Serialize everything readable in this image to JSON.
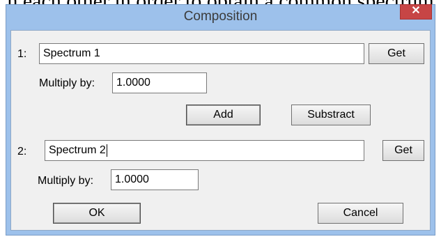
{
  "background_text": "h each other in order to obtain a common spectrum",
  "window": {
    "title": "Composition",
    "close_glyph": "✕"
  },
  "row1": {
    "index_label": "1:",
    "spectrum_value": "Spectrum 1",
    "get_label": "Get",
    "multiply_label": "Multiply by:",
    "multiply_value": "1.0000"
  },
  "ops": {
    "add_label": "Add",
    "substract_label": "Substract"
  },
  "row2": {
    "index_label": "2:",
    "spectrum_value": "Spectrum 2",
    "get_label": "Get",
    "multiply_label": "Multiply by:",
    "multiply_value": "1.0000"
  },
  "actions": {
    "ok_label": "OK",
    "cancel_label": "Cancel"
  },
  "colors": {
    "frame": "#9dc1eb",
    "client": "#f0f0f0",
    "close": "#c74545"
  }
}
